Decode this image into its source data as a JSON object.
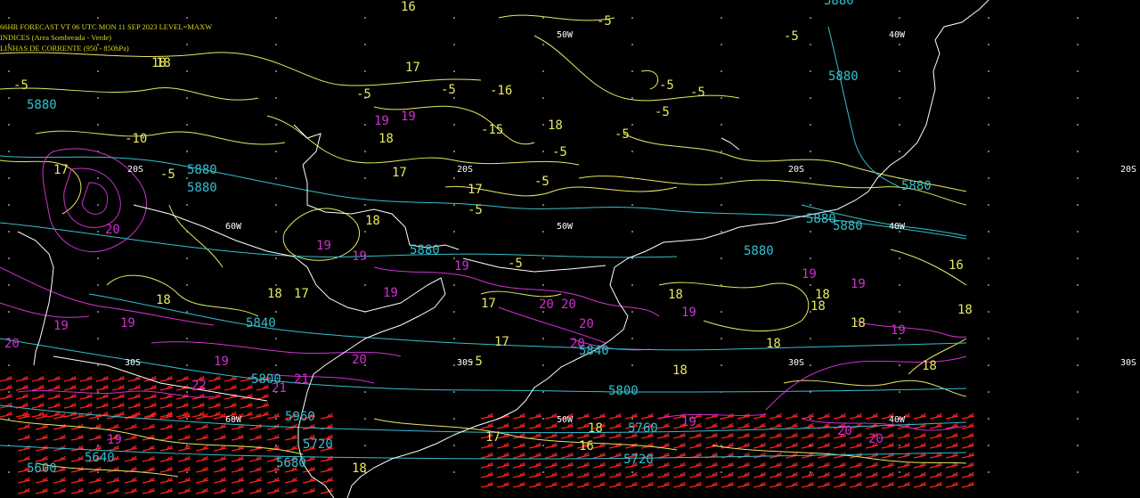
{
  "header": {
    "line1": "66HR FORECAST   VT 06 UTC MON 11 SEP 2023   LEVEL=MAXW",
    "line2": "INDICES (Area Sombreada - Verde)",
    "line3": "LINHAS DE CORRENTE (950 - 850hPa)"
  },
  "colors": {
    "background": "#000000",
    "coastline": "#ffffff",
    "geopotential": "#33c0d0",
    "yellow_contours": "#e8e860",
    "magenta_contours": "#d030d0",
    "wind_barbs": "#ff2020",
    "grid": "#ffffff"
  },
  "grid_labels": [
    {
      "text": "50W"
    },
    {
      "text": "40W"
    },
    {
      "text": "20S"
    },
    {
      "text": "60W"
    },
    {
      "text": "50W"
    },
    {
      "text": "40W"
    },
    {
      "text": "20S"
    },
    {
      "text": "20S"
    },
    {
      "text": "30S"
    },
    {
      "text": "30S"
    },
    {
      "text": "30S"
    },
    {
      "text": "50W"
    },
    {
      "text": "40W"
    },
    {
      "text": "30S"
    },
    {
      "text": "20S"
    },
    {
      "text": "60W"
    }
  ],
  "cyan_labels": [
    "5880",
    "5880",
    "5880",
    "5880",
    "5880",
    "5880",
    "5880",
    "5880",
    "5880",
    "5880",
    "5840",
    "5840",
    "5800",
    "5800",
    "5760",
    "5720",
    "5720",
    "5680",
    "5640",
    "5600",
    "5960"
  ],
  "yellow_labels": [
    "16",
    "18",
    "17",
    "18",
    "-5",
    "-5",
    "-5",
    "-5",
    "-5",
    "-5",
    "-5",
    "-5",
    "-5",
    "-5",
    "-5",
    "18",
    "17",
    "18",
    "17",
    "17",
    "18",
    "18",
    "18",
    "16",
    "18",
    "18",
    "18",
    "18",
    "18",
    "17",
    "18",
    "17",
    "18",
    "17",
    "18",
    "16",
    "-5",
    "-5",
    "-10",
    "-15",
    "-16",
    "18",
    "18",
    "-5",
    "17",
    "-5"
  ],
  "magenta_labels": [
    "19",
    "19",
    "19",
    "19",
    "19",
    "19",
    "19",
    "19",
    "19",
    "20",
    "20",
    "20",
    "20",
    "20",
    "20",
    "21",
    "22",
    "19",
    "19",
    "19",
    "20",
    "19",
    "20",
    "19",
    "19",
    "21",
    "20"
  ]
}
